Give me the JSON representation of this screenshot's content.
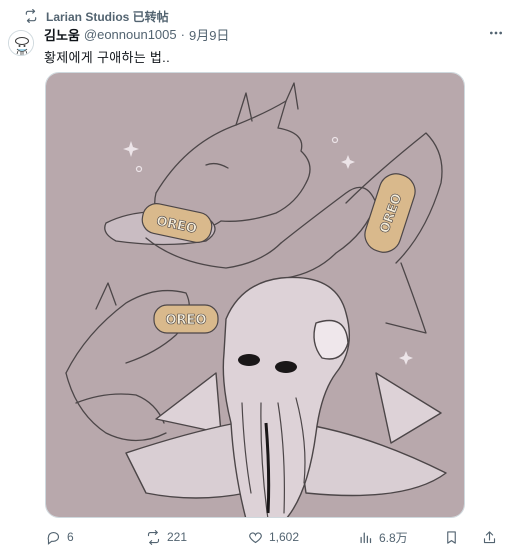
{
  "repost": {
    "text": "Larian Studios 已转帖",
    "icon": "repost-icon"
  },
  "author": {
    "name": "김노움",
    "handle": "@eonnoun1005",
    "sep": "·",
    "date": "9月9日"
  },
  "tweet": {
    "text": "황제에게 구애하는 법.."
  },
  "media": {
    "cookie_labels": [
      "OREO",
      "OREO",
      "OREO"
    ],
    "colors": {
      "background": "#b7a7ab",
      "line": "#4c4648",
      "cookie": "#d9b98c",
      "cream": "#f4ecd8",
      "skin": "#d8cbd1"
    }
  },
  "actions": {
    "replies": "6",
    "reposts": "221",
    "likes": "1,602",
    "views": "6.8万"
  },
  "icons": [
    "repost-icon",
    "more-icon",
    "reply-icon",
    "retweet-icon",
    "like-icon",
    "views-icon",
    "bookmark-icon",
    "share-icon"
  ]
}
